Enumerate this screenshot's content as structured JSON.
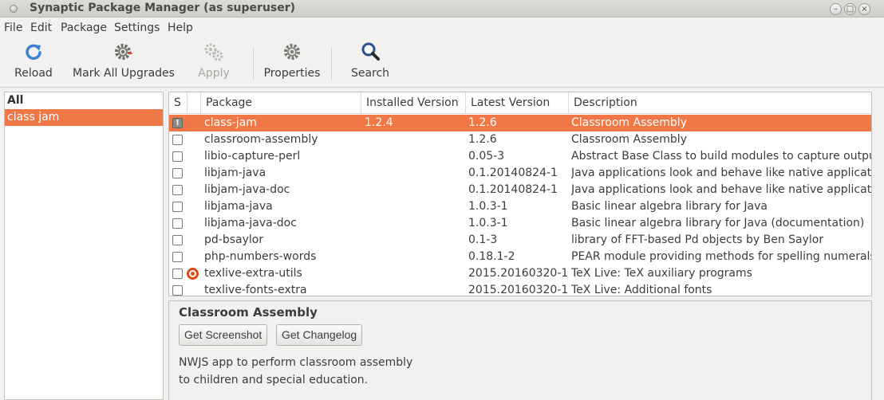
{
  "window": {
    "title": "Synaptic Package Manager  (as superuser)",
    "controls": {
      "minimize": "–",
      "maximize": "□",
      "close": "×"
    }
  },
  "menu": [
    "File",
    "Edit",
    "Package",
    "Settings",
    "Help"
  ],
  "toolbar": {
    "reload": {
      "label": "Reload",
      "icon": "reload-icon"
    },
    "mark_all_upgrades": {
      "label": "Mark All Upgrades",
      "icon": "gear-icon"
    },
    "apply": {
      "label": "Apply",
      "icon": "gears-icon",
      "disabled": true
    },
    "properties": {
      "label": "Properties",
      "icon": "gear-icon"
    },
    "search": {
      "label": "Search",
      "icon": "search-icon"
    }
  },
  "filters": {
    "header": "All",
    "items": [
      "class jam"
    ]
  },
  "columns": {
    "status": "S",
    "package": "Package",
    "installed": "Installed Version",
    "latest": "Latest Version",
    "description": "Description"
  },
  "packages": [
    {
      "name": "class-jam",
      "installed": "1.2.4",
      "latest": "1.2.6",
      "description": "Classroom Assembly",
      "status": "broken",
      "selected": true
    },
    {
      "name": "classroom-assembly",
      "installed": "",
      "latest": "1.2.6",
      "description": "Classroom Assembly"
    },
    {
      "name": "libio-capture-perl",
      "installed": "",
      "latest": "0.05-3",
      "description": "Abstract Base Class to build modules to capture output"
    },
    {
      "name": "libjam-java",
      "installed": "",
      "latest": "0.1.20140824-1",
      "description": "Java applications look and behave like native applicatio"
    },
    {
      "name": "libjam-java-doc",
      "installed": "",
      "latest": "0.1.20140824-1",
      "description": "Java applications look and behave like native applicatio"
    },
    {
      "name": "libjama-java",
      "installed": "",
      "latest": "1.0.3-1",
      "description": "Basic linear algebra library for Java"
    },
    {
      "name": "libjama-java-doc",
      "installed": "",
      "latest": "1.0.3-1",
      "description": "Basic linear algebra library for Java (documentation)"
    },
    {
      "name": "pd-bsaylor",
      "installed": "",
      "latest": "0.1-3",
      "description": "library of FFT-based Pd objects by Ben Saylor"
    },
    {
      "name": "php-numbers-words",
      "installed": "",
      "latest": "0.18.1-2",
      "description": "PEAR module providing methods for spelling numerals"
    },
    {
      "name": "texlive-extra-utils",
      "installed": "",
      "latest": "2015.20160320-1",
      "description": "TeX Live: TeX auxiliary programs",
      "supported": true
    },
    {
      "name": "texlive-fonts-extra",
      "installed": "",
      "latest": "2015.20160320-1",
      "description": "TeX Live: Additional fonts"
    }
  ],
  "details": {
    "title": "Classroom Assembly",
    "get_screenshot": "Get Screenshot",
    "get_changelog": "Get Changelog",
    "description_lines": [
      "NWJS app to perform classroom assembly",
      "to children and special education."
    ]
  },
  "colors": {
    "selection": "#f07746",
    "ubuntu": "#dd4814"
  }
}
